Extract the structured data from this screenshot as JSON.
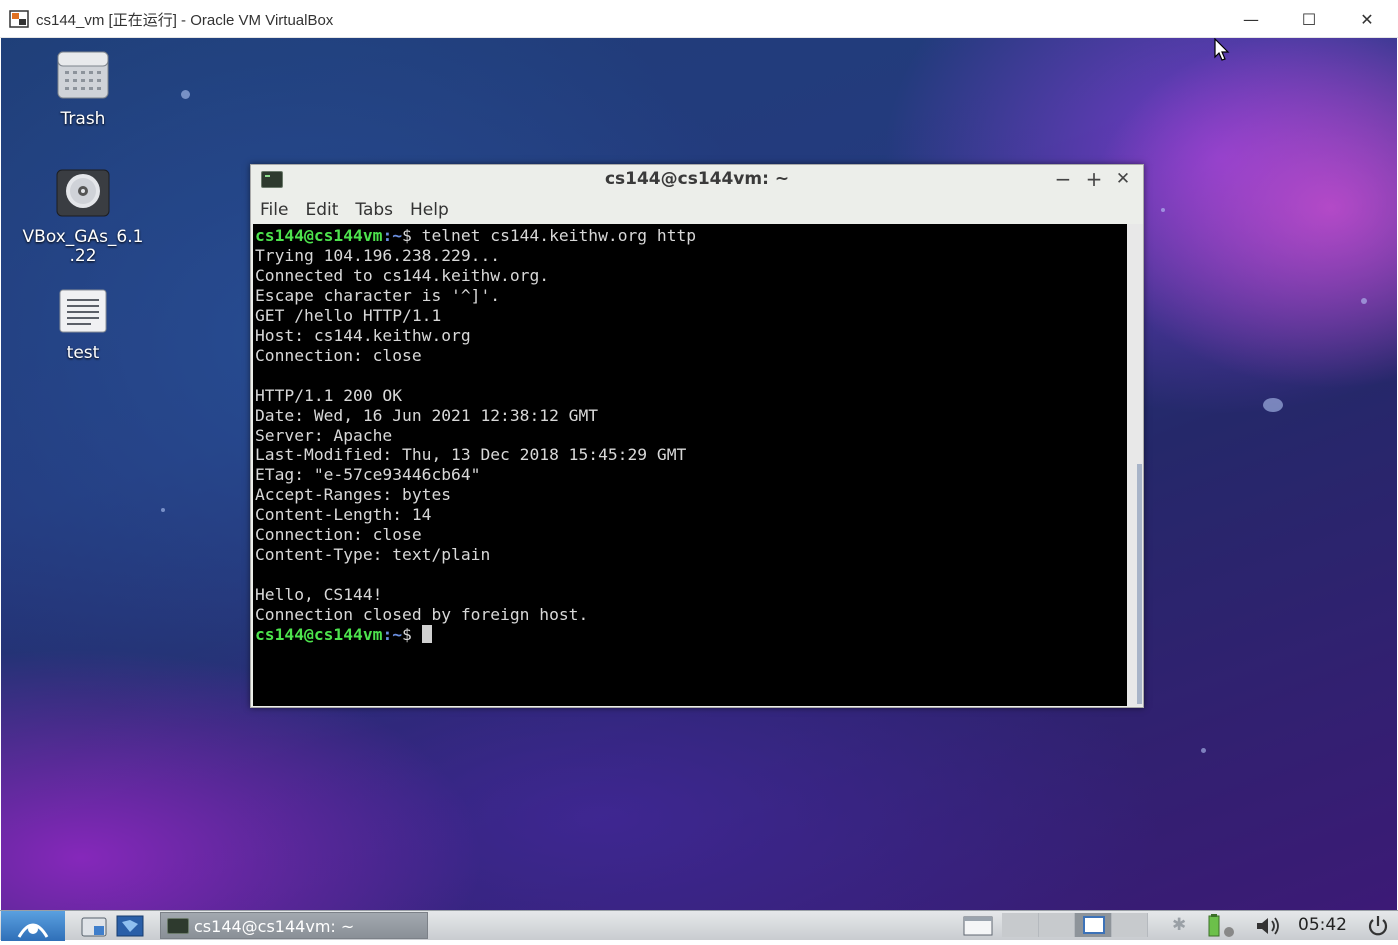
{
  "host_window": {
    "title": "cs144_vm [正在运行] - Oracle VM VirtualBox",
    "minimize_glyph": "—",
    "maximize_glyph": "☐",
    "close_glyph": "✕"
  },
  "desktop": {
    "icons": [
      {
        "label": "Trash",
        "icon": "trash-icon"
      },
      {
        "label": "VBox_GAs_6.1\n.22",
        "icon": "cd-disc-icon"
      },
      {
        "label": "test",
        "icon": "text-file-icon"
      }
    ]
  },
  "terminal": {
    "title": "cs144@cs144vm: ~",
    "menu": [
      "File",
      "Edit",
      "Tabs",
      "Help"
    ],
    "prompt_user": "cs144@cs144vm",
    "prompt_path": ":~",
    "prompt_symbol": "$",
    "command": " telnet cs144.keithw.org http",
    "output": [
      "Trying 104.196.238.229...",
      "Connected to cs144.keithw.org.",
      "Escape character is '^]'.",
      "GET /hello HTTP/1.1",
      "Host: cs144.keithw.org",
      "Connection: close",
      "",
      "HTTP/1.1 200 OK",
      "Date: Wed, 16 Jun 2021 12:38:12 GMT",
      "Server: Apache",
      "Last-Modified: Thu, 13 Dec 2018 15:45:29 GMT",
      "ETag: \"e-57ce93446cb64\"",
      "Accept-Ranges: bytes",
      "Content-Length: 14",
      "Connection: close",
      "Content-Type: text/plain",
      "",
      "Hello, CS144!",
      "Connection closed by foreign host."
    ],
    "window_buttons": {
      "minimize": "−",
      "maximize": "+",
      "close": "✕"
    }
  },
  "taskbar": {
    "task_label": "cs144@cs144vm: ~",
    "clock": "05:42"
  }
}
